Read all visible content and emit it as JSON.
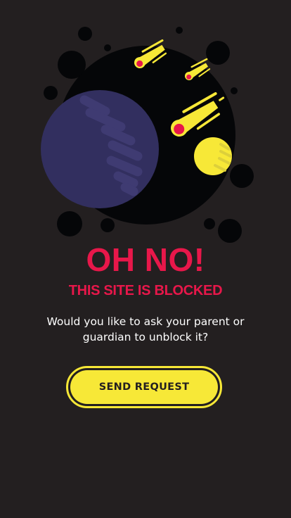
{
  "headline": "OH NO!",
  "subheadline": "THIS SITE IS BLOCKED",
  "message": "Would you like to ask your parent or guardian to unblock it?",
  "button": {
    "label": "SEND REQUEST"
  },
  "colors": {
    "background": "#231f20",
    "accent_red": "#e8174a",
    "accent_yellow": "#f7e837",
    "planet_purple": "#322f5f",
    "space_black": "#050608"
  },
  "illustration": {
    "icons": [
      "space-circle-icon",
      "planet-icon",
      "moon-icon",
      "meteor-icon",
      "bubble-icon"
    ]
  }
}
